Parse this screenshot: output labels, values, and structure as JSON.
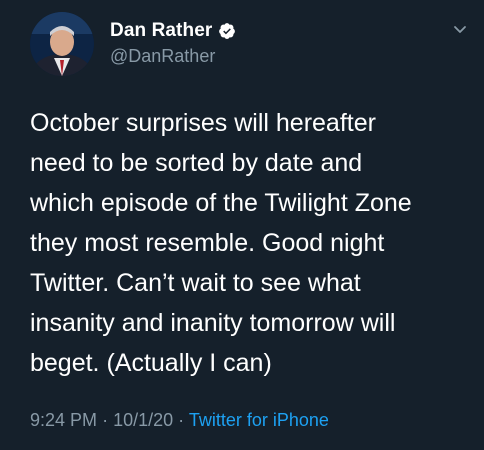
{
  "author": {
    "display_name": "Dan Rather",
    "handle": "@DanRather",
    "verified": true
  },
  "tweet": {
    "text": "October surprises will hereafter\nneed to be sorted by date and\nwhich episode of the Twilight Zone\nthey most resemble.  Good night\nTwitter. Can’t wait to see what\ninsanity and inanity tomorrow will\nbeget. (Actually I can)",
    "time": "9:24 PM",
    "date": "10/1/20",
    "separator": "·",
    "source": "Twitter for iPhone"
  },
  "icons": {
    "verified": "verified-badge-icon",
    "menu": "chevron-down-icon"
  },
  "colors": {
    "background": "#15202b",
    "text": "#ffffff",
    "secondary": "#8899a6",
    "accent": "#1da1f2"
  }
}
